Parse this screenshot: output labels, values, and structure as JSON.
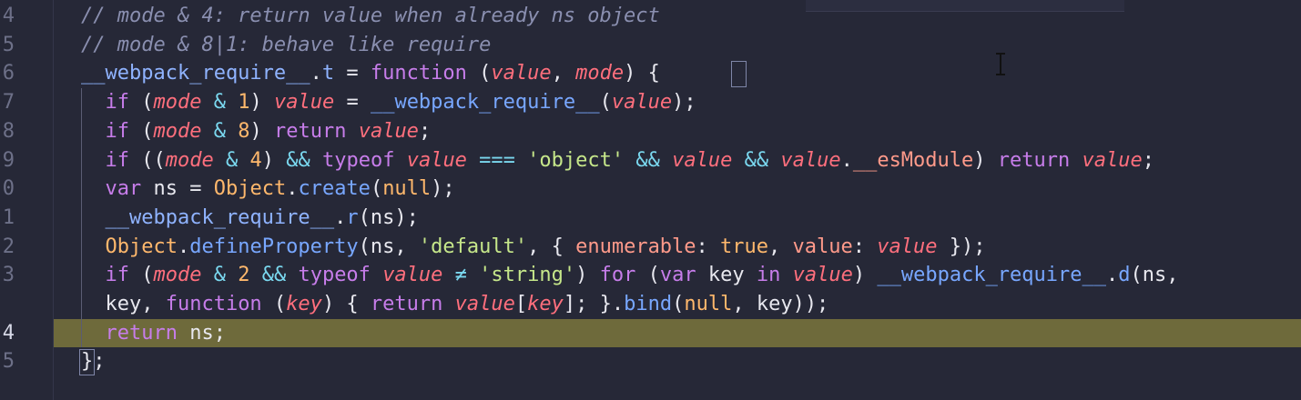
{
  "line_numbers": [
    "4",
    "5",
    "6",
    "7",
    "8",
    "9",
    "0",
    "1",
    "2",
    "3",
    "",
    "4",
    "5"
  ],
  "code_lines": [
    {
      "spans": [
        {
          "text": "// mode & 4: return value when already ns object",
          "cls": "c"
        }
      ]
    },
    {
      "spans": [
        {
          "text": "// mode & 8|1: behave like require",
          "cls": "c"
        }
      ]
    },
    {
      "spans": [
        {
          "text": "__webpack_require__",
          "cls": "id"
        },
        {
          "text": ".",
          "cls": "p"
        },
        {
          "text": "t",
          "cls": "id"
        },
        {
          "text": " = ",
          "cls": "p"
        },
        {
          "text": "function",
          "cls": "k"
        },
        {
          "text": " (",
          "cls": "p"
        },
        {
          "text": "value",
          "cls": "v"
        },
        {
          "text": ", ",
          "cls": "p"
        },
        {
          "text": "mode",
          "cls": "v"
        },
        {
          "text": ") {",
          "cls": "p"
        }
      ]
    },
    {
      "spans": [
        {
          "text": "  if",
          "cls": "k"
        },
        {
          "text": " (",
          "cls": "p"
        },
        {
          "text": "mode",
          "cls": "v"
        },
        {
          "text": " & ",
          "cls": "o"
        },
        {
          "text": "1",
          "cls": "n"
        },
        {
          "text": ") ",
          "cls": "p"
        },
        {
          "text": "value",
          "cls": "v"
        },
        {
          "text": " = ",
          "cls": "p"
        },
        {
          "text": "__webpack_require__",
          "cls": "f"
        },
        {
          "text": "(",
          "cls": "p"
        },
        {
          "text": "value",
          "cls": "v"
        },
        {
          "text": ");",
          "cls": "p"
        }
      ]
    },
    {
      "spans": [
        {
          "text": "  if",
          "cls": "k"
        },
        {
          "text": " (",
          "cls": "p"
        },
        {
          "text": "mode",
          "cls": "v"
        },
        {
          "text": " & ",
          "cls": "o"
        },
        {
          "text": "8",
          "cls": "n"
        },
        {
          "text": ") ",
          "cls": "p"
        },
        {
          "text": "return",
          "cls": "k"
        },
        {
          "text": " ",
          "cls": "p"
        },
        {
          "text": "value",
          "cls": "v"
        },
        {
          "text": ";",
          "cls": "p"
        }
      ]
    },
    {
      "spans": [
        {
          "text": "  if",
          "cls": "k"
        },
        {
          "text": " ((",
          "cls": "p"
        },
        {
          "text": "mode",
          "cls": "v"
        },
        {
          "text": " & ",
          "cls": "o"
        },
        {
          "text": "4",
          "cls": "n"
        },
        {
          "text": ") ",
          "cls": "p"
        },
        {
          "text": "&&",
          "cls": "o"
        },
        {
          "text": " ",
          "cls": "p"
        },
        {
          "text": "typeof",
          "cls": "k"
        },
        {
          "text": " ",
          "cls": "p"
        },
        {
          "text": "value",
          "cls": "v"
        },
        {
          "text": " === ",
          "cls": "o"
        },
        {
          "text": "'object'",
          "cls": "s"
        },
        {
          "text": " && ",
          "cls": "o"
        },
        {
          "text": "value",
          "cls": "v"
        },
        {
          "text": " && ",
          "cls": "o"
        },
        {
          "text": "value",
          "cls": "v"
        },
        {
          "text": ".",
          "cls": "p"
        },
        {
          "text": "__esModule",
          "cls": "prop"
        },
        {
          "text": ") ",
          "cls": "p"
        },
        {
          "text": "return",
          "cls": "k"
        },
        {
          "text": " ",
          "cls": "p"
        },
        {
          "text": "value",
          "cls": "v"
        },
        {
          "text": ";",
          "cls": "p"
        }
      ]
    },
    {
      "spans": [
        {
          "text": "  var",
          "cls": "k"
        },
        {
          "text": " ns = ",
          "cls": "p"
        },
        {
          "text": "Object",
          "cls": "n"
        },
        {
          "text": ".",
          "cls": "p"
        },
        {
          "text": "create",
          "cls": "f"
        },
        {
          "text": "(",
          "cls": "p"
        },
        {
          "text": "null",
          "cls": "n"
        },
        {
          "text": ");",
          "cls": "p"
        }
      ]
    },
    {
      "spans": [
        {
          "text": "  __webpack_require__",
          "cls": "id"
        },
        {
          "text": ".",
          "cls": "p"
        },
        {
          "text": "r",
          "cls": "f"
        },
        {
          "text": "(ns);",
          "cls": "p"
        }
      ]
    },
    {
      "spans": [
        {
          "text": "  Object",
          "cls": "n"
        },
        {
          "text": ".",
          "cls": "p"
        },
        {
          "text": "defineProperty",
          "cls": "f"
        },
        {
          "text": "(ns, ",
          "cls": "p"
        },
        {
          "text": "'default'",
          "cls": "s"
        },
        {
          "text": ", { ",
          "cls": "p"
        },
        {
          "text": "enumerable",
          "cls": "prop"
        },
        {
          "text": ": ",
          "cls": "p"
        },
        {
          "text": "true",
          "cls": "n"
        },
        {
          "text": ", ",
          "cls": "p"
        },
        {
          "text": "value",
          "cls": "prop"
        },
        {
          "text": ": ",
          "cls": "p"
        },
        {
          "text": "value",
          "cls": "v"
        },
        {
          "text": " });",
          "cls": "p"
        }
      ]
    },
    {
      "spans": [
        {
          "text": "  if",
          "cls": "k"
        },
        {
          "text": " (",
          "cls": "p"
        },
        {
          "text": "mode",
          "cls": "v"
        },
        {
          "text": " & ",
          "cls": "o"
        },
        {
          "text": "2",
          "cls": "n"
        },
        {
          "text": " && ",
          "cls": "o"
        },
        {
          "text": "typeof",
          "cls": "k"
        },
        {
          "text": " ",
          "cls": "p"
        },
        {
          "text": "value",
          "cls": "v"
        },
        {
          "text": " ≠ ",
          "cls": "o"
        },
        {
          "text": "'string'",
          "cls": "s"
        },
        {
          "text": ") ",
          "cls": "p"
        },
        {
          "text": "for",
          "cls": "k"
        },
        {
          "text": " (",
          "cls": "p"
        },
        {
          "text": "var",
          "cls": "k"
        },
        {
          "text": " key ",
          "cls": "p"
        },
        {
          "text": "in",
          "cls": "k"
        },
        {
          "text": " ",
          "cls": "p"
        },
        {
          "text": "value",
          "cls": "v"
        },
        {
          "text": ") ",
          "cls": "p"
        },
        {
          "text": "__webpack_require__",
          "cls": "f"
        },
        {
          "text": ".",
          "cls": "p"
        },
        {
          "text": "d",
          "cls": "f"
        },
        {
          "text": "(ns,",
          "cls": "p"
        }
      ]
    },
    {
      "spans": [
        {
          "text": "  key, ",
          "cls": "p"
        },
        {
          "text": "function",
          "cls": "k"
        },
        {
          "text": " (",
          "cls": "p"
        },
        {
          "text": "key",
          "cls": "v"
        },
        {
          "text": ") { ",
          "cls": "p"
        },
        {
          "text": "return",
          "cls": "k"
        },
        {
          "text": " ",
          "cls": "p"
        },
        {
          "text": "value",
          "cls": "v"
        },
        {
          "text": "[",
          "cls": "p"
        },
        {
          "text": "key",
          "cls": "v"
        },
        {
          "text": "]; }.",
          "cls": "p"
        },
        {
          "text": "bind",
          "cls": "f"
        },
        {
          "text": "(",
          "cls": "p"
        },
        {
          "text": "null",
          "cls": "n"
        },
        {
          "text": ", key));",
          "cls": "p"
        }
      ]
    },
    {
      "spans": [
        {
          "text": "  return",
          "cls": "k"
        },
        {
          "text": " ns;",
          "cls": "p"
        }
      ],
      "highlight": true
    },
    {
      "spans": [
        {
          "text": "};",
          "cls": "p"
        }
      ]
    }
  ]
}
